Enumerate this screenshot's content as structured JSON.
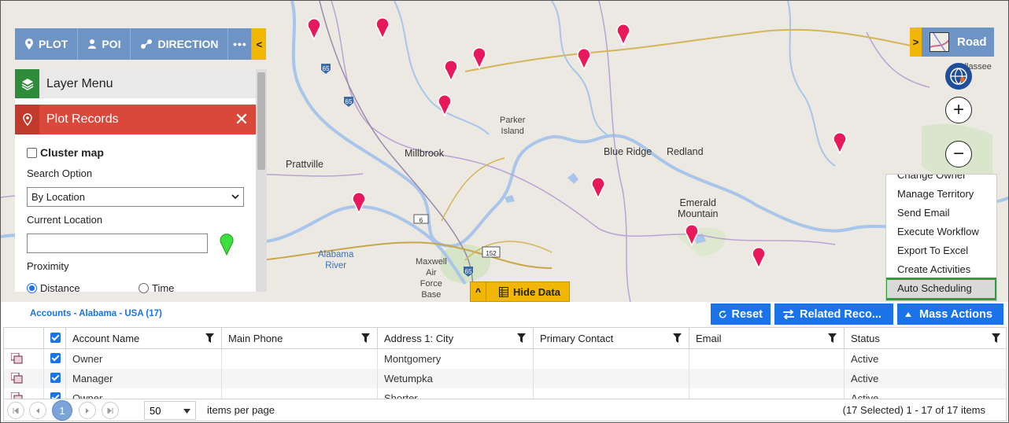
{
  "toolbar": {
    "plot_label": "PLOT",
    "poi_label": "POI",
    "direction_label": "DIRECTION",
    "more_label": "•••",
    "toggle_glyph": "<"
  },
  "map_type": {
    "label": "Road",
    "toggle_glyph": ">"
  },
  "map": {
    "places": [
      {
        "label": "Prattville",
        "kind": "town"
      },
      {
        "label": "Millbrook",
        "kind": "town"
      },
      {
        "label": "Parker\nIsland",
        "kind": "small"
      },
      {
        "label": "Blue Ridge",
        "kind": "town"
      },
      {
        "label": "Redland",
        "kind": "town"
      },
      {
        "label": "Emerald\nMountain",
        "kind": "town"
      },
      {
        "label": "Alabama\nRiver",
        "kind": "water"
      },
      {
        "label": "Maxwell\nAir\nForce\nBase",
        "kind": "small"
      },
      {
        "label": "Tallassee",
        "kind": "town"
      }
    ],
    "road_shields": [
      "65",
      "65",
      "6",
      "152",
      "65"
    ],
    "pin_color": "#e8185d",
    "zoom_in": "+",
    "zoom_out": "−"
  },
  "layer_menu": {
    "label": "Layer Menu"
  },
  "plot_records": {
    "title": "Plot Records",
    "close": "✕",
    "cluster_map": "Cluster map",
    "search_option_label": "Search Option",
    "search_option_value": "By Location",
    "current_location_label": "Current Location",
    "current_location_value": "",
    "proximity_label": "Proximity",
    "distance_label": "Distance",
    "time_label": "Time"
  },
  "hide_data": {
    "label": "Hide Data",
    "arrow": "^"
  },
  "mass_menu": {
    "items": [
      "Change Owner",
      "Manage Territory",
      "Send Email",
      "Execute Workflow",
      "Export To Excel",
      "Create Activities",
      "Auto Scheduling"
    ],
    "highlight_color": "#2e9c3f"
  },
  "grid": {
    "title": "Accounts - Alabama - USA (17)",
    "reset_label": "Reset",
    "related_label": "Related Reco...",
    "mass_actions_label": "Mass Actions",
    "accent": "#1a73e8",
    "columns": [
      "Account Name",
      "Main Phone",
      "Address 1: City",
      "Primary Contact",
      "Email",
      "Status"
    ],
    "rows": [
      {
        "account": "Owner",
        "phone": "",
        "city": "Montgomery",
        "contact": "",
        "email": "",
        "status": "Active"
      },
      {
        "account": "Manager",
        "phone": "",
        "city": "Wetumpka",
        "contact": "",
        "email": "",
        "status": "Active"
      },
      {
        "account": "Owner",
        "phone": "",
        "city": "Shorter",
        "contact": "",
        "email": "",
        "status": "Active"
      }
    ]
  },
  "pager": {
    "current_page": "1",
    "page_size": "50",
    "per_page_label": "items per page",
    "info": "(17 Selected) 1 - 17 of 17 items"
  }
}
